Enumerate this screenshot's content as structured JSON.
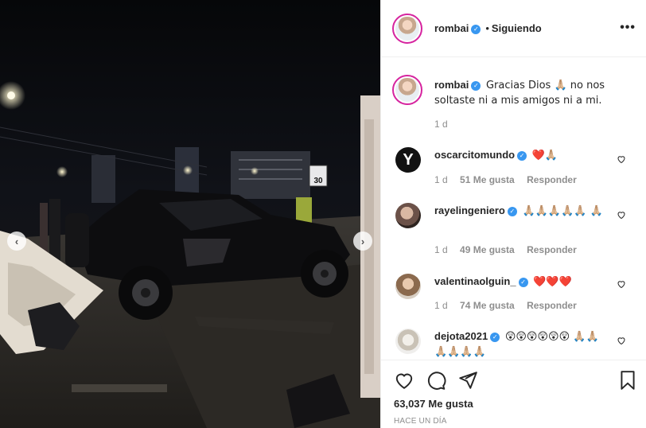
{
  "post": {
    "author": "rombai",
    "follow_status": "Siguiendo",
    "dot": "•",
    "more": "•••",
    "caption": "Gracias Dios 🙏🏼 no nos soltaste ni a mis amigos ni a mi.",
    "caption_time": "1 d",
    "likes": "63,037 Me gusta",
    "posted": "HACE UN DÍA"
  },
  "comments": [
    {
      "user": "oscarcitomundo",
      "verified": true,
      "text": "❤️🙏🏼",
      "time": "1 d",
      "likes": "51 Me gusta",
      "reply": "Responder"
    },
    {
      "user": "rayelingeniero",
      "verified": true,
      "text": "🙏🏼🙏🏼🙏🏼🙏🏼🙏🏼 🙏🏼",
      "time": "1 d",
      "likes": "49 Me gusta",
      "reply": "Responder"
    },
    {
      "user": "valentinaolguin_",
      "verified": true,
      "text": "❤️❤️❤️",
      "time": "1 d",
      "likes": "74 Me gusta",
      "reply": "Responder"
    },
    {
      "user": "dejota2021",
      "verified": true,
      "text": "😲😲😲😲😲😲 🙏🏼🙏🏼🙏🏼🙏🏼🙏🏼🙏🏼",
      "time": "",
      "likes": "",
      "reply": ""
    }
  ],
  "photo": {
    "sign_speed": "30",
    "sign_label": "SPEED LIMIT"
  },
  "icons": {
    "verified": "verified-badge-icon",
    "like": "heart-icon",
    "comment": "comment-icon",
    "share": "share-icon",
    "save": "bookmark-icon",
    "prev": "chevron-left-icon",
    "next": "chevron-right-icon"
  },
  "colors": {
    "verified": "#3897f0",
    "text": "#262626",
    "muted": "#8e8e8e",
    "ring": "#d6249f"
  }
}
